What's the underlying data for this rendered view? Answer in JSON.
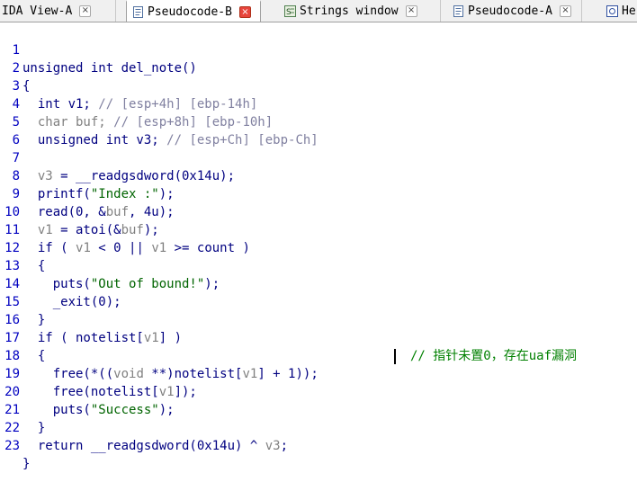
{
  "tabs": [
    {
      "label": "IDA View-A",
      "icon": "ida-view-icon",
      "active": false
    },
    {
      "label": "Pseudocode-B",
      "icon": "pseudocode-icon",
      "active": true
    },
    {
      "label": "Strings window",
      "icon": "strings-icon",
      "active": false
    },
    {
      "label": "Pseudocode-A",
      "icon": "pseudocode-icon",
      "active": false
    },
    {
      "label": "He",
      "icon": "hex-view-icon",
      "active": false
    }
  ],
  "tab_close_glyph": "×",
  "colors": {
    "keyword": "#000080",
    "variable": "#808080",
    "comment": "#8080a0",
    "string": "#006400",
    "line_number": "#0000c0",
    "active_close": "#e8453c"
  },
  "code": {
    "line_numbers": [
      "1",
      "2",
      "3",
      "4",
      "5",
      "6",
      "7",
      "8",
      "9",
      "10",
      "11",
      "12",
      "13",
      "14",
      "15",
      "16",
      "17",
      "18",
      "19",
      "20",
      "21",
      "22",
      "23"
    ],
    "l1": "unsigned int del_note()",
    "l2": "{",
    "l3_a": "  int v1; ",
    "l3_b": "// [esp+4h] [ebp-14h]",
    "l4_a": "  char buf; ",
    "l4_b": "// [esp+8h] [ebp-10h]",
    "l5_a": "  unsigned int v3; ",
    "l5_b": "// [esp+Ch] [ebp-Ch]",
    "l6": "",
    "l7_v": "v3",
    "l7_r": " = __readgsdword(0x14u);",
    "l8_a": "  printf(",
    "l8_s": "\"Index :\"",
    "l8_b": ");",
    "l9_a": "  read(0, &",
    "l9_v": "buf",
    "l9_b": ", 4u);",
    "l10_v1": "v1",
    "l10_a": " = atoi(&",
    "l10_v2": "buf",
    "l10_b": ");",
    "l11_a": "  if ( ",
    "l11_v1": "v1",
    "l11_b": " < 0 || ",
    "l11_v2": "v1",
    "l11_c": " >= count )",
    "l12": "  {",
    "l13_a": "    puts(",
    "l13_s": "\"Out of bound!\"",
    "l13_b": ");",
    "l14": "    _exit(0);",
    "l15": "  }",
    "l16_a": "  if ( notelist[",
    "l16_v": "v1",
    "l16_b": "] )",
    "l17": "  {",
    "l18_a": "    free(*((",
    "l18_k": "void",
    "l18_b": " **)notelist[",
    "l18_v": "v1",
    "l18_c": "] + 1));",
    "l19_a": "    free(notelist[",
    "l19_v": "v1",
    "l19_b": "]);",
    "l19_comment": "// 指针未置0，存在uaf漏洞",
    "l20_a": "    puts(",
    "l20_s": "\"Success\"",
    "l20_b": ");",
    "l21": "  }",
    "l22_a": "  return __readgsdword(0x14u) ^ ",
    "l22_v": "v3",
    "l22_b": ";",
    "l23": "}"
  }
}
